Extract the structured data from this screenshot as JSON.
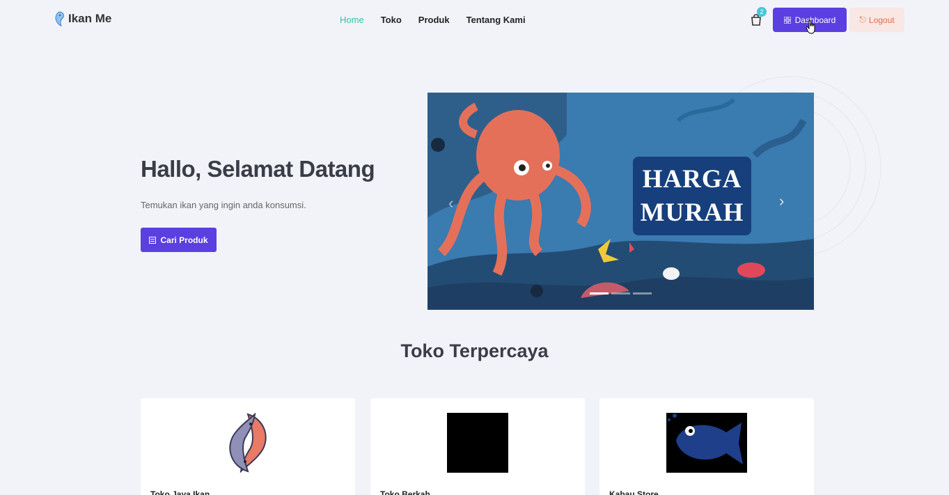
{
  "header": {
    "brand": "Ikan Me",
    "nav": [
      {
        "label": "Home",
        "active": true
      },
      {
        "label": "Toko",
        "active": false
      },
      {
        "label": "Produk",
        "active": false
      },
      {
        "label": "Tentang Kami",
        "active": false
      }
    ],
    "cart_count": "2",
    "dashboard_label": "Dashboard",
    "logout_label": "Logout",
    "icons": {
      "cart": "shopping-bag-icon",
      "dashboard": "grid-icon",
      "logout": "logout-icon"
    }
  },
  "hero": {
    "title": "Hallo, Selamat Datang",
    "subtitle": "Temukan ikan yang ingin anda konsumsi.",
    "cta_label": "Cari Produk",
    "carousel": {
      "banner_lines": [
        "HARGA",
        "MURAH"
      ],
      "active_slide": 1,
      "slide_count": 3
    }
  },
  "section": {
    "title": "Toko Terpercaya",
    "stores": [
      {
        "name": "Toko Jaya Ikan",
        "image": "fish-yin-yang-logo"
      },
      {
        "name": "Toko Berkah",
        "image": "black-square"
      },
      {
        "name": "Kabau Store",
        "image": "blue-fish-logo"
      }
    ]
  },
  "colors": {
    "primary": "#5b3fe0",
    "active_nav": "#2ec4a5",
    "logout_bg": "#f9e7e4",
    "logout_text": "#e46a4c",
    "page_bg": "#f1f3f8"
  }
}
